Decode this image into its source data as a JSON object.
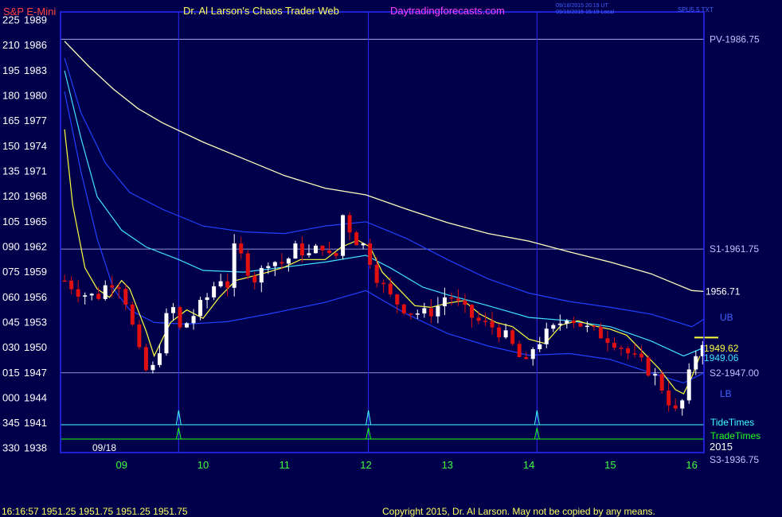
{
  "header": {
    "symbol": "S&P E-Mini",
    "author": "Dr. Al Larson's Chaos Trader Web",
    "site": "Daytradingforecasts.com",
    "stamp1": "09/18/2015 20:19 UT",
    "stamp2": "09/18/2015 15:19 Local",
    "badge": "SPU5 5 TXT"
  },
  "footer": {
    "quote": "16:16:57  1951.25  1951.75  1951.25  1951.75",
    "copyright": "Copyright 2015, Dr. Al Larson. May not be copied by any means."
  },
  "colors": {
    "background": "#00004a",
    "frame": "#2a2aff",
    "up_candle": "#ffffff",
    "down_candle": "#e01010",
    "fast_avg": "#ffff40",
    "mid_avg": "#40e0ff",
    "band": "#2040ff",
    "slow_avg": "#ffffc0",
    "tide": "#40ffff",
    "trade": "#20ff20",
    "level": "#c0c0ff"
  },
  "chart_data": {
    "type": "candlestick",
    "y_range": [
      1937.5,
      1990
    ],
    "y_ticks": [
      {
        "price": 1989,
        "left": "225",
        "right": "1989"
      },
      {
        "price": 1986,
        "left": "210",
        "right": "1986"
      },
      {
        "price": 1983,
        "left": "195",
        "right": "1983"
      },
      {
        "price": 1980,
        "left": "180",
        "right": "1980"
      },
      {
        "price": 1977,
        "left": "165",
        "right": "1977"
      },
      {
        "price": 1974,
        "left": "150",
        "right": "1974"
      },
      {
        "price": 1971,
        "left": "135",
        "right": "1971"
      },
      {
        "price": 1968,
        "left": "120",
        "right": "1968"
      },
      {
        "price": 1965,
        "left": "105",
        "right": "1965"
      },
      {
        "price": 1962,
        "left": "090",
        "right": "1962"
      },
      {
        "price": 1959,
        "left": "075",
        "right": "1959"
      },
      {
        "price": 1956,
        "left": "060",
        "right": "1956"
      },
      {
        "price": 1953,
        "left": "045",
        "right": "1953"
      },
      {
        "price": 1950,
        "left": "030",
        "right": "1950"
      },
      {
        "price": 1947,
        "left": "015",
        "right": "1947"
      },
      {
        "price": 1944,
        "left": "000",
        "right": "1944"
      },
      {
        "price": 1941,
        "left": "345",
        "right": "1941"
      },
      {
        "price": 1938,
        "left": "330",
        "right": "1938"
      }
    ],
    "x_range": [
      8.25,
      16.15
    ],
    "x_ticks": [
      {
        "hour": 9,
        "label": "09"
      },
      {
        "hour": 10,
        "label": "10"
      },
      {
        "hour": 11,
        "label": "11"
      },
      {
        "hour": 12,
        "label": "12"
      },
      {
        "hour": 13,
        "label": "13"
      },
      {
        "hour": 14,
        "label": "14"
      },
      {
        "hour": 15,
        "label": "15"
      },
      {
        "hour": 16,
        "label": "16"
      }
    ],
    "date_label": "09/18",
    "year_label": "2015",
    "levels": [
      {
        "label": "PV-1986.75",
        "price": 1986.75
      },
      {
        "label": "S1-1961.75",
        "price": 1961.75
      },
      {
        "label": "S2-1947.00",
        "price": 1947.0
      },
      {
        "label": "S3-1936.75",
        "price": 1936.75
      }
    ],
    "value_labels": [
      {
        "text": "1956.71",
        "price": 1956.71
      },
      {
        "text": "1949.62",
        "price": 1949.62
      },
      {
        "text": "1949.06",
        "price": 1949.06
      }
    ],
    "band_labels": {
      "upper": "UB",
      "lower": "LB"
    },
    "tide_times": {
      "label": "TideTimes",
      "hours": [
        9.7,
        12.03,
        14.1
      ]
    },
    "trade_times": {
      "label": "TradeTimes",
      "hours": [
        9.7,
        12.03,
        14.1
      ]
    },
    "series": {
      "slow_avg": [
        [
          8.3,
          1986.5
        ],
        [
          8.6,
          1983.5
        ],
        [
          8.9,
          1980.8
        ],
        [
          9.2,
          1978.5
        ],
        [
          9.5,
          1976.8
        ],
        [
          10,
          1974.5
        ],
        [
          10.5,
          1972.5
        ],
        [
          11,
          1970.5
        ],
        [
          11.5,
          1969
        ],
        [
          12,
          1968.2
        ],
        [
          12.5,
          1966.5
        ],
        [
          13,
          1964.9
        ],
        [
          13.5,
          1963.6
        ],
        [
          14,
          1962.7
        ],
        [
          14.5,
          1961.4
        ],
        [
          15,
          1960.2
        ],
        [
          15.5,
          1958.8
        ],
        [
          16,
          1956.8
        ],
        [
          16.15,
          1956.7
        ]
      ],
      "upper_band": [
        [
          8.3,
          1984.5
        ],
        [
          8.5,
          1978
        ],
        [
          8.8,
          1972
        ],
        [
          9.1,
          1968.5
        ],
        [
          9.5,
          1966.5
        ],
        [
          10,
          1964.5
        ],
        [
          10.5,
          1963.8
        ],
        [
          11,
          1963.6
        ],
        [
          11.5,
          1964.5
        ],
        [
          12,
          1965
        ],
        [
          12.5,
          1963
        ],
        [
          13,
          1960.5
        ],
        [
          13.5,
          1958.2
        ],
        [
          14,
          1956.5
        ],
        [
          14.5,
          1955.5
        ],
        [
          15,
          1954.8
        ],
        [
          15.5,
          1954
        ],
        [
          16,
          1952.5
        ],
        [
          16.15,
          1953.4
        ]
      ],
      "mid_avg": [
        [
          8.3,
          1983
        ],
        [
          8.5,
          1975
        ],
        [
          8.7,
          1968
        ],
        [
          9,
          1964
        ],
        [
          9.3,
          1962
        ],
        [
          9.7,
          1960.5
        ],
        [
          10,
          1959.2
        ],
        [
          10.5,
          1959
        ],
        [
          11,
          1959.6
        ],
        [
          11.5,
          1960.2
        ],
        [
          12,
          1961
        ],
        [
          12.3,
          1959.5
        ],
        [
          12.7,
          1957.2
        ],
        [
          13,
          1956.3
        ],
        [
          13.5,
          1955
        ],
        [
          14,
          1953.6
        ],
        [
          14.5,
          1953.2
        ],
        [
          15,
          1952.5
        ],
        [
          15.5,
          1950.8
        ],
        [
          15.9,
          1949
        ],
        [
          16.15,
          1950
        ]
      ],
      "lower_band": [
        [
          8.3,
          1980.5
        ],
        [
          8.5,
          1971
        ],
        [
          8.7,
          1963
        ],
        [
          8.9,
          1957
        ],
        [
          9.1,
          1954.5
        ],
        [
          9.4,
          1953
        ],
        [
          9.8,
          1952.8
        ],
        [
          10.3,
          1953.1
        ],
        [
          10.8,
          1954
        ],
        [
          11.5,
          1955.4
        ],
        [
          12,
          1956.8
        ],
        [
          12.5,
          1954
        ],
        [
          13,
          1951.7
        ],
        [
          13.5,
          1950.2
        ],
        [
          14,
          1949.1
        ],
        [
          14.5,
          1949.3
        ],
        [
          15,
          1948.6
        ],
        [
          15.5,
          1947
        ],
        [
          15.9,
          1945.8
        ],
        [
          16.15,
          1947
        ]
      ],
      "fast_avg": [
        [
          8.3,
          1976
        ],
        [
          8.4,
          1967
        ],
        [
          8.55,
          1959.5
        ],
        [
          8.7,
          1957
        ],
        [
          8.85,
          1956
        ],
        [
          9,
          1958
        ],
        [
          9.1,
          1957
        ],
        [
          9.3,
          1952
        ],
        [
          9.4,
          1949
        ],
        [
          9.6,
          1953
        ],
        [
          9.8,
          1954.5
        ],
        [
          10,
          1953.5
        ],
        [
          10.2,
          1956
        ],
        [
          10.4,
          1958
        ],
        [
          10.6,
          1958.5
        ],
        [
          10.8,
          1959
        ],
        [
          11,
          1959.6
        ],
        [
          11.2,
          1960.5
        ],
        [
          11.5,
          1960.5
        ],
        [
          11.7,
          1962
        ],
        [
          11.9,
          1962.8
        ],
        [
          12.05,
          1962
        ],
        [
          12.2,
          1959
        ],
        [
          12.4,
          1957
        ],
        [
          12.6,
          1955
        ],
        [
          12.8,
          1954.8
        ],
        [
          13,
          1955.3
        ],
        [
          13.2,
          1955.6
        ],
        [
          13.4,
          1954
        ],
        [
          13.6,
          1953
        ],
        [
          13.8,
          1952.5
        ],
        [
          14,
          1951
        ],
        [
          14.2,
          1950.5
        ],
        [
          14.4,
          1952.7
        ],
        [
          14.6,
          1953.2
        ],
        [
          14.8,
          1952.6
        ],
        [
          15,
          1952.2
        ],
        [
          15.2,
          1951.5
        ],
        [
          15.4,
          1949.5
        ],
        [
          15.6,
          1947.5
        ],
        [
          15.8,
          1945
        ],
        [
          15.9,
          1944.5
        ],
        [
          16,
          1946.5
        ],
        [
          16.1,
          1949
        ]
      ],
      "close_path": [
        [
          8.3,
          1958
        ],
        [
          8.5,
          1956.5
        ],
        [
          8.7,
          1956
        ],
        [
          8.85,
          1958
        ],
        [
          9.0,
          1957.5
        ],
        [
          9.12,
          1953
        ],
        [
          9.25,
          1948
        ],
        [
          9.35,
          1946.5
        ],
        [
          9.5,
          1951
        ],
        [
          9.6,
          1956
        ],
        [
          9.7,
          1952
        ],
        [
          9.85,
          1953.5
        ],
        [
          10.05,
          1956
        ],
        [
          10.2,
          1958.5
        ],
        [
          10.3,
          1957.5
        ],
        [
          10.4,
          1962.5
        ],
        [
          10.5,
          1960
        ],
        [
          10.65,
          1958
        ],
        [
          10.8,
          1960.5
        ],
        [
          11.0,
          1960
        ],
        [
          11.15,
          1962
        ],
        [
          11.3,
          1961
        ],
        [
          11.5,
          1962.5
        ],
        [
          11.6,
          1959
        ],
        [
          11.72,
          1966
        ],
        [
          11.85,
          1963
        ],
        [
          12.0,
          1962
        ],
        [
          12.1,
          1959
        ],
        [
          12.3,
          1956
        ],
        [
          12.5,
          1954.5
        ],
        [
          12.7,
          1954
        ],
        [
          12.85,
          1954.5
        ],
        [
          13.0,
          1956.5
        ],
        [
          13.1,
          1955.5
        ],
        [
          13.25,
          1954
        ],
        [
          13.4,
          1953
        ],
        [
          13.55,
          1952.5
        ],
        [
          13.7,
          1951.5
        ],
        [
          13.85,
          1949.5
        ],
        [
          13.95,
          1947.5
        ],
        [
          14.05,
          1950
        ],
        [
          14.2,
          1951.5
        ],
        [
          14.35,
          1952.5
        ],
        [
          14.45,
          1954
        ],
        [
          14.6,
          1953
        ],
        [
          14.75,
          1952
        ],
        [
          14.9,
          1951.5
        ],
        [
          15.0,
          1951
        ],
        [
          15.1,
          1950.5
        ],
        [
          15.25,
          1949
        ],
        [
          15.4,
          1948
        ],
        [
          15.55,
          1946.5
        ],
        [
          15.65,
          1945
        ],
        [
          15.75,
          1943
        ],
        [
          15.82,
          1942
        ],
        [
          15.9,
          1944
        ],
        [
          16.0,
          1948
        ],
        [
          16.08,
          1950
        ],
        [
          16.15,
          1951.2
        ]
      ]
    }
  }
}
